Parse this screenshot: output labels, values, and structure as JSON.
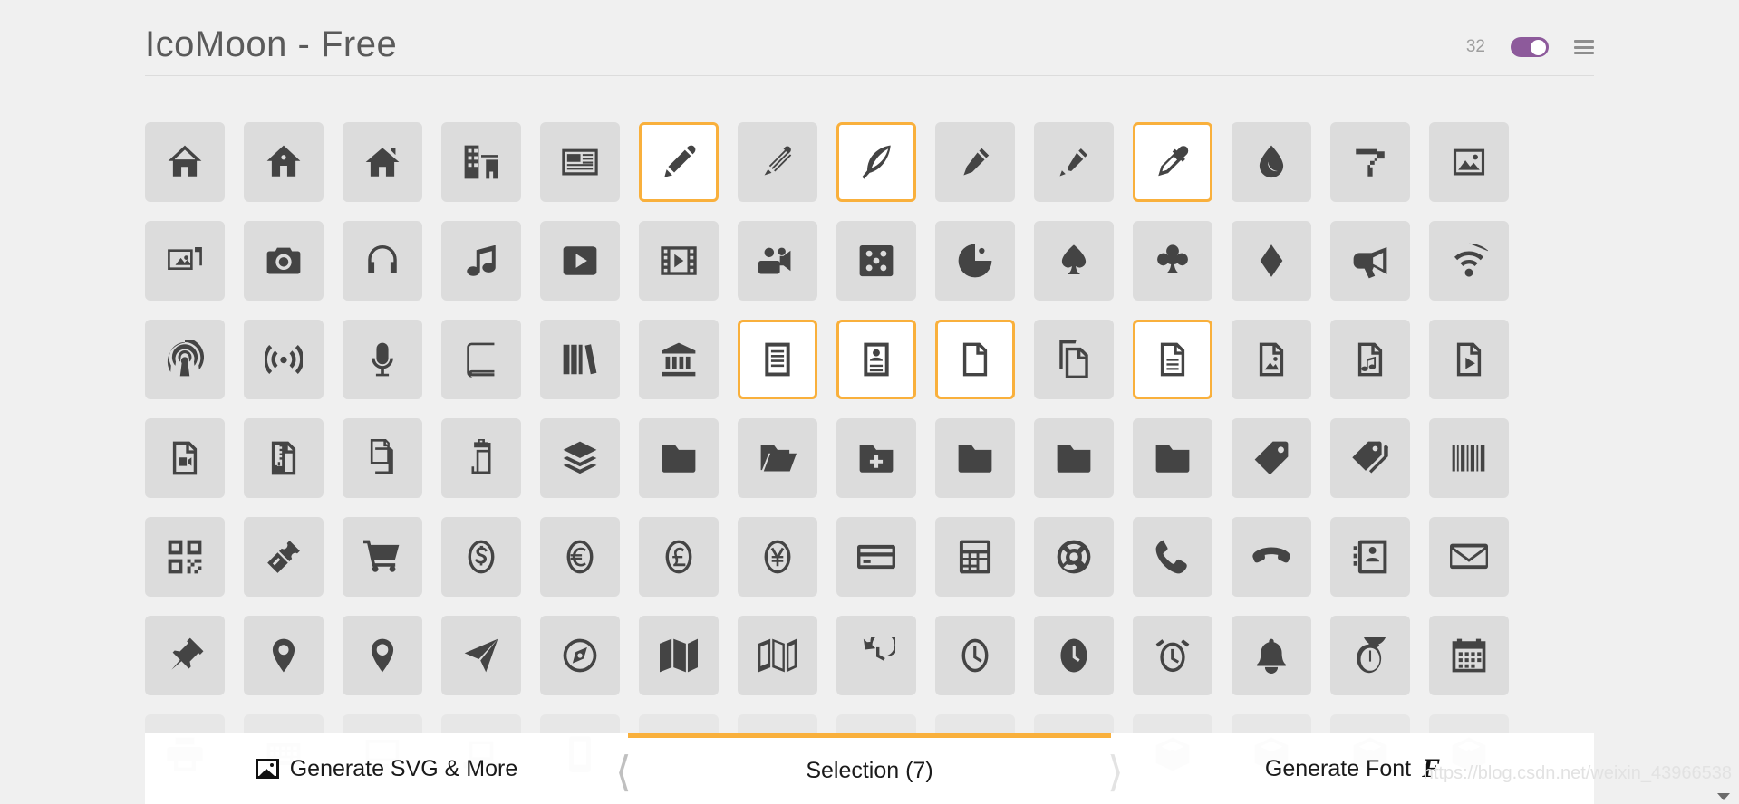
{
  "header": {
    "title": "IcoMoon - Free",
    "count": "32",
    "toggle_state": "on",
    "menu_icon": "hamburger-menu-icon",
    "accent_purple": "#8d5a9b"
  },
  "theme": {
    "page_bg": "#f0f0f0",
    "tile_bg": "#dcdcdc",
    "tile_selected_bg": "#ffffff",
    "selection_border": "#f9b03c",
    "icon_color": "#444444",
    "title_color": "#5a5a5a"
  },
  "selection": {
    "count": 7,
    "label": "Selection (7)"
  },
  "bottom_bar": {
    "left_label": "Generate SVG & More",
    "left_icon": "image-icon",
    "center_label": "Selection (7)",
    "right_label": "Generate Font",
    "right_icon": "font-f-glyph",
    "prev_icon": "chevron-left-icon",
    "next_icon": "chevron-right-icon"
  },
  "watermark": "https://blog.csdn.net/weixin_43966538",
  "grid": {
    "columns": 14,
    "rows": [
      {
        "row": 1,
        "icons": [
          {
            "name": "home",
            "selected": false
          },
          {
            "name": "home2",
            "selected": false
          },
          {
            "name": "home3",
            "selected": false
          },
          {
            "name": "office",
            "selected": false
          },
          {
            "name": "newspaper",
            "selected": false
          },
          {
            "name": "pencil",
            "selected": true
          },
          {
            "name": "pencil2",
            "selected": false
          },
          {
            "name": "quill",
            "selected": true
          },
          {
            "name": "pen",
            "selected": false
          },
          {
            "name": "blog",
            "selected": false
          },
          {
            "name": "eyedropper",
            "selected": true
          },
          {
            "name": "droplet",
            "selected": false
          },
          {
            "name": "paint-format",
            "selected": false
          },
          {
            "name": "image",
            "selected": false
          }
        ]
      },
      {
        "row": 2,
        "icons": [
          {
            "name": "images",
            "selected": false
          },
          {
            "name": "camera",
            "selected": false
          },
          {
            "name": "headphones",
            "selected": false
          },
          {
            "name": "music",
            "selected": false
          },
          {
            "name": "play",
            "selected": false
          },
          {
            "name": "film",
            "selected": false
          },
          {
            "name": "video-camera",
            "selected": false
          },
          {
            "name": "dice",
            "selected": false
          },
          {
            "name": "pacman",
            "selected": false
          },
          {
            "name": "spades",
            "selected": false
          },
          {
            "name": "clubs",
            "selected": false
          },
          {
            "name": "diamonds",
            "selected": false
          },
          {
            "name": "bullhorn",
            "selected": false
          },
          {
            "name": "connection",
            "selected": false
          }
        ]
      },
      {
        "row": 3,
        "icons": [
          {
            "name": "podcast",
            "selected": false
          },
          {
            "name": "feed",
            "selected": false
          },
          {
            "name": "mic",
            "selected": false
          },
          {
            "name": "book",
            "selected": false
          },
          {
            "name": "books",
            "selected": false
          },
          {
            "name": "library",
            "selected": false
          },
          {
            "name": "file-text",
            "selected": true
          },
          {
            "name": "profile",
            "selected": true
          },
          {
            "name": "file-empty",
            "selected": true
          },
          {
            "name": "files-empty",
            "selected": false
          },
          {
            "name": "file-text2",
            "selected": true
          },
          {
            "name": "file-picture",
            "selected": false
          },
          {
            "name": "file-music",
            "selected": false
          },
          {
            "name": "file-play",
            "selected": false
          }
        ]
      },
      {
        "row": 4,
        "icons": [
          {
            "name": "file-video",
            "selected": false
          },
          {
            "name": "file-zip",
            "selected": false
          },
          {
            "name": "copy",
            "selected": false
          },
          {
            "name": "paste",
            "selected": false
          },
          {
            "name": "stack",
            "selected": false
          },
          {
            "name": "folder",
            "selected": false
          },
          {
            "name": "folder-open",
            "selected": false
          },
          {
            "name": "folder-plus",
            "selected": false
          },
          {
            "name": "folder-minus",
            "selected": false
          },
          {
            "name": "folder-download",
            "selected": false
          },
          {
            "name": "folder-upload",
            "selected": false
          },
          {
            "name": "price-tag",
            "selected": false
          },
          {
            "name": "price-tags",
            "selected": false
          },
          {
            "name": "barcode",
            "selected": false
          }
        ]
      },
      {
        "row": 5,
        "icons": [
          {
            "name": "qrcode",
            "selected": false
          },
          {
            "name": "ticket",
            "selected": false
          },
          {
            "name": "cart",
            "selected": false
          },
          {
            "name": "coin-dollar",
            "selected": false
          },
          {
            "name": "coin-euro",
            "selected": false
          },
          {
            "name": "coin-pound",
            "selected": false
          },
          {
            "name": "coin-yen",
            "selected": false
          },
          {
            "name": "credit-card",
            "selected": false
          },
          {
            "name": "calculator",
            "selected": false
          },
          {
            "name": "lifebuoy",
            "selected": false
          },
          {
            "name": "phone",
            "selected": false
          },
          {
            "name": "phone-hang-up",
            "selected": false
          },
          {
            "name": "address-book",
            "selected": false
          },
          {
            "name": "envelop",
            "selected": false
          }
        ]
      },
      {
        "row": 6,
        "icons": [
          {
            "name": "pushpin",
            "selected": false
          },
          {
            "name": "location",
            "selected": false
          },
          {
            "name": "location2",
            "selected": false
          },
          {
            "name": "compass",
            "selected": false
          },
          {
            "name": "compass2",
            "selected": false
          },
          {
            "name": "map",
            "selected": false
          },
          {
            "name": "map2",
            "selected": false
          },
          {
            "name": "history",
            "selected": false
          },
          {
            "name": "clock",
            "selected": false
          },
          {
            "name": "clock2",
            "selected": false
          },
          {
            "name": "alarm",
            "selected": false
          },
          {
            "name": "bell",
            "selected": false
          },
          {
            "name": "stopwatch",
            "selected": false
          },
          {
            "name": "calendar",
            "selected": false
          }
        ]
      },
      {
        "row": 7,
        "icons": [
          {
            "name": "printer",
            "selected": false
          },
          {
            "name": "keyboard",
            "selected": false
          },
          {
            "name": "display",
            "selected": false
          },
          {
            "name": "laptop",
            "selected": false
          },
          {
            "name": "mobile",
            "selected": false
          },
          {
            "name": "mobile2",
            "selected": false
          },
          {
            "name": "tablet",
            "selected": false
          },
          {
            "name": "tv",
            "selected": false
          },
          {
            "name": "drawer",
            "selected": false
          },
          {
            "name": "drawer2",
            "selected": false
          },
          {
            "name": "box-add",
            "selected": false
          },
          {
            "name": "box-remove",
            "selected": false
          },
          {
            "name": "download",
            "selected": false
          },
          {
            "name": "upload",
            "selected": false
          }
        ]
      }
    ]
  }
}
